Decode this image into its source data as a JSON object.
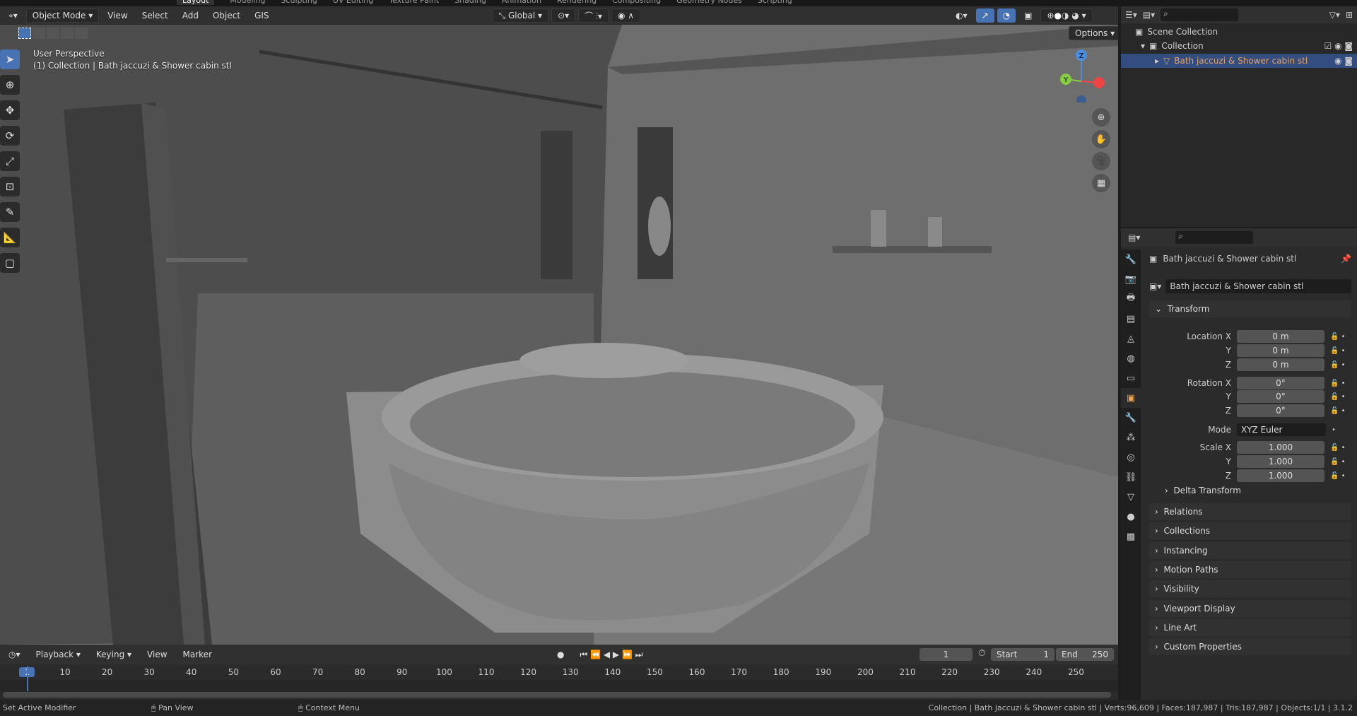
{
  "workspace_tabs": [
    "Layout",
    "Modeling",
    "Sculpting",
    "UV Editing",
    "Texture Paint",
    "Shading",
    "Animation",
    "Rendering",
    "Compositing",
    "Geometry Nodes",
    "Scripting"
  ],
  "header": {
    "mode": "Object Mode",
    "menus": [
      "View",
      "Select",
      "Add",
      "Object",
      "GIS"
    ],
    "orientation": "Global",
    "options": "Options"
  },
  "viewport": {
    "perspective": "User Perspective",
    "context": "(1) Collection | Bath jaccuzi & Shower cabin stl",
    "gizmo": {
      "z": "Z",
      "y": "Y"
    }
  },
  "outliner": {
    "scene_collection": "Scene Collection",
    "collection": "Collection",
    "object": "Bath jaccuzi & Shower cabin stl"
  },
  "properties": {
    "object_title": "Bath jaccuzi & Shower cabin stl",
    "object_name": "Bath jaccuzi & Shower cabin stl",
    "transform": "Transform",
    "rows": [
      {
        "label": "Location X",
        "value": "0 m"
      },
      {
        "label": "Y",
        "value": "0 m"
      },
      {
        "label": "Z",
        "value": "0 m"
      },
      {
        "label": "Rotation X",
        "value": "0°"
      },
      {
        "label": "Y",
        "value": "0°"
      },
      {
        "label": "Z",
        "value": "0°"
      },
      {
        "label": "Mode",
        "value": "XYZ Euler"
      },
      {
        "label": "Scale X",
        "value": "1.000"
      },
      {
        "label": "Y",
        "value": "1.000"
      },
      {
        "label": "Z",
        "value": "1.000"
      }
    ],
    "delta": "Delta Transform",
    "sections": [
      "Relations",
      "Collections",
      "Instancing",
      "Motion Paths",
      "Visibility",
      "Viewport Display",
      "Line Art",
      "Custom Properties"
    ]
  },
  "timeline": {
    "menus": [
      "Playback",
      "Keying",
      "View",
      "Marker"
    ],
    "current_frame": "1",
    "start_label": "Start",
    "start": "1",
    "end_label": "End",
    "end": "250",
    "ticks": [
      "1",
      "10",
      "20",
      "30",
      "40",
      "50",
      "60",
      "70",
      "80",
      "90",
      "100",
      "110",
      "120",
      "130",
      "140",
      "150",
      "160",
      "170",
      "180",
      "190",
      "200",
      "210",
      "220",
      "230",
      "240",
      "250"
    ]
  },
  "status": {
    "left": "Set Active Modifier",
    "middle": "Pan View",
    "right": "Context Menu",
    "info": "Collection | Bath jaccuzi & Shower cabin stl | Verts:96,609 | Faces:187,987 | Tris:187,987 | Objects:1/1 | 3.1.2"
  },
  "colors": {
    "accent": "#4772b3",
    "selected_row": "#334d80",
    "object_text": "#e8a25a"
  }
}
